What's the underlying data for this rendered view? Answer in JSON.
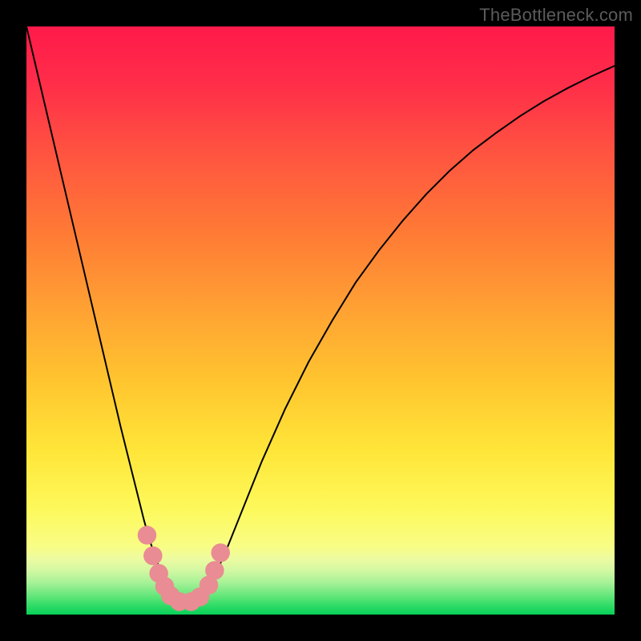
{
  "watermark": "TheBottleneck.com",
  "chart_data": {
    "type": "line",
    "title": "",
    "xlabel": "",
    "ylabel": "",
    "xlim": [
      0,
      100
    ],
    "ylim": [
      0,
      100
    ],
    "grid": false,
    "legend": false,
    "series": [
      {
        "name": "bottleneck-curve",
        "x": [
          0,
          2,
          4,
          6,
          8,
          10,
          12,
          14,
          16,
          18,
          20,
          21,
          22,
          23,
          24,
          25,
          26,
          27,
          28,
          29,
          30,
          31,
          32,
          34,
          36,
          38,
          40,
          44,
          48,
          52,
          56,
          60,
          64,
          68,
          72,
          76,
          80,
          84,
          88,
          92,
          96,
          100
        ],
        "y": [
          100,
          91.5,
          83,
          74.5,
          66,
          57.5,
          49,
          40.5,
          32,
          24,
          16,
          12.5,
          9.5,
          7,
          5,
          3.5,
          2.5,
          2,
          2,
          2.3,
          3,
          4.5,
          6.5,
          11,
          16,
          21,
          26,
          35,
          43,
          50,
          56.5,
          62,
          67,
          71.5,
          75.5,
          79,
          82,
          84.8,
          87.3,
          89.5,
          91.5,
          93.3
        ],
        "color": "#000000",
        "stroke_width": 2
      }
    ],
    "markers": [
      {
        "x": 20.5,
        "y": 13.5,
        "r": 1.6,
        "color": "#e98c93"
      },
      {
        "x": 21.5,
        "y": 10.0,
        "r": 1.6,
        "color": "#e98c93"
      },
      {
        "x": 22.5,
        "y": 7.0,
        "r": 1.6,
        "color": "#e98c93"
      },
      {
        "x": 23.5,
        "y": 4.8,
        "r": 1.6,
        "color": "#e98c93"
      },
      {
        "x": 24.5,
        "y": 3.2,
        "r": 1.6,
        "color": "#e98c93"
      },
      {
        "x": 26.0,
        "y": 2.2,
        "r": 1.6,
        "color": "#e98c93"
      },
      {
        "x": 28.0,
        "y": 2.2,
        "r": 1.6,
        "color": "#e98c93"
      },
      {
        "x": 29.5,
        "y": 3.0,
        "r": 1.6,
        "color": "#e98c93"
      },
      {
        "x": 31.0,
        "y": 5.0,
        "r": 1.6,
        "color": "#e98c93"
      },
      {
        "x": 32.0,
        "y": 7.5,
        "r": 1.6,
        "color": "#e98c93"
      },
      {
        "x": 33.0,
        "y": 10.5,
        "r": 1.6,
        "color": "#e98c93"
      }
    ],
    "background_gradient": {
      "type": "vertical",
      "stops": [
        {
          "offset": 0.0,
          "color": "#ff1a4b"
        },
        {
          "offset": 0.1,
          "color": "#ff2e49"
        },
        {
          "offset": 0.22,
          "color": "#ff5540"
        },
        {
          "offset": 0.35,
          "color": "#ff7a35"
        },
        {
          "offset": 0.48,
          "color": "#ffa133"
        },
        {
          "offset": 0.6,
          "color": "#ffc42f"
        },
        {
          "offset": 0.72,
          "color": "#ffe538"
        },
        {
          "offset": 0.82,
          "color": "#fdf95b"
        },
        {
          "offset": 0.885,
          "color": "#f8fd86"
        },
        {
          "offset": 0.905,
          "color": "#edfba0"
        },
        {
          "offset": 0.925,
          "color": "#d3f8a3"
        },
        {
          "offset": 0.945,
          "color": "#a8f298"
        },
        {
          "offset": 0.965,
          "color": "#6ee87e"
        },
        {
          "offset": 0.985,
          "color": "#2fdc66"
        },
        {
          "offset": 1.0,
          "color": "#07d158"
        }
      ]
    }
  }
}
